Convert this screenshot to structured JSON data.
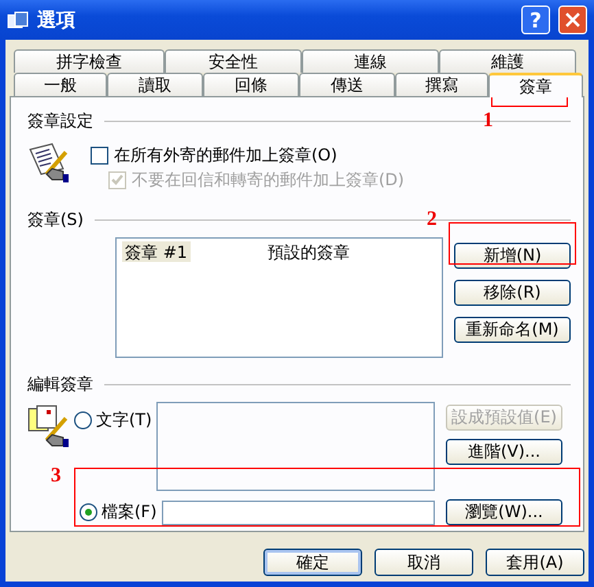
{
  "window": {
    "title": "選項",
    "help_glyph": "?"
  },
  "tab_rows": [
    [
      {
        "label": "拼字檢查",
        "selected": false
      },
      {
        "label": "安全性",
        "selected": false
      },
      {
        "label": "連線",
        "selected": false
      },
      {
        "label": "維護",
        "selected": false
      }
    ],
    [
      {
        "label": "一般",
        "selected": false
      },
      {
        "label": "讀取",
        "selected": false
      },
      {
        "label": "回條",
        "selected": false
      },
      {
        "label": "傳送",
        "selected": false
      },
      {
        "label": "撰寫",
        "selected": false
      },
      {
        "label": "簽章",
        "selected": true
      }
    ]
  ],
  "settings_group": {
    "title": "簽章設定",
    "checkboxes": [
      {
        "label": "在所有外寄的郵件加上簽章(O)",
        "checked": false,
        "disabled": false
      },
      {
        "label": "不要在回信和轉寄的郵件加上簽章(D)",
        "checked": true,
        "disabled": true
      }
    ]
  },
  "signatures_group": {
    "title": "簽章(S)",
    "rows": [
      {
        "name": "簽章 #1",
        "note": "預設的簽章",
        "selected": true
      }
    ],
    "buttons": [
      {
        "label": "新增(N)",
        "disabled": false
      },
      {
        "label": "移除(R)",
        "disabled": false
      },
      {
        "label": "重新命名(M)",
        "disabled": false
      }
    ]
  },
  "edit_group": {
    "title": "編輯簽章",
    "text_option": {
      "label": "文字(T)",
      "selected": false
    },
    "file_option": {
      "label": "檔案(F)",
      "selected": true
    },
    "buttons": [
      {
        "label": "設成預設值(E)",
        "disabled": true
      },
      {
        "label": "進階(V)...",
        "disabled": false
      }
    ],
    "browse_button": "瀏覽(W)..."
  },
  "footer_buttons": [
    {
      "label": "確定",
      "default": true
    },
    {
      "label": "取消",
      "default": false
    },
    {
      "label": "套用(A)",
      "default": false
    }
  ],
  "annotations": [
    "1",
    "2",
    "3"
  ]
}
